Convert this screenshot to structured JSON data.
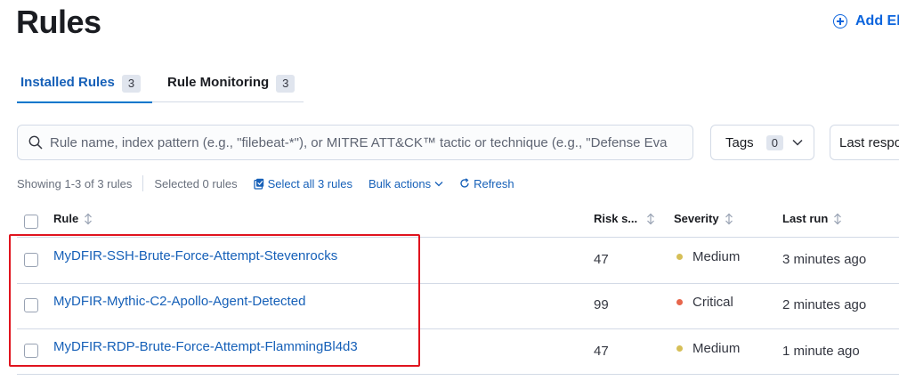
{
  "page": {
    "title": "Rules"
  },
  "header": {
    "add_button_label": "Add Ela"
  },
  "tabs": [
    {
      "label": "Installed Rules",
      "count": "3",
      "active": true
    },
    {
      "label": "Rule Monitoring",
      "count": "3",
      "active": false
    }
  ],
  "search": {
    "placeholder": "Rule name, index pattern (e.g., \"filebeat-*\"), or MITRE ATT&CK™ tactic or technique (e.g., \"Defense Eva"
  },
  "filters": {
    "tags_label": "Tags",
    "tags_count": "0",
    "last_response_label": "Last respo"
  },
  "toolbar": {
    "showing": "Showing 1-3 of 3 rules",
    "selected": "Selected 0 rules",
    "select_all": "Select all 3 rules",
    "bulk_actions": "Bulk actions",
    "refresh": "Refresh"
  },
  "table": {
    "columns": {
      "rule": "Rule",
      "risk": "Risk s...",
      "severity": "Severity",
      "last_run": "Last run"
    },
    "rows": [
      {
        "name": "MyDFIR-SSH-Brute-Force-Attempt-Stevenrocks",
        "risk": "47",
        "severity": "Medium",
        "severity_color": "#d6bf57",
        "last_run": "3 minutes ago"
      },
      {
        "name": "MyDFIR-Mythic-C2-Apollo-Agent-Detected",
        "risk": "99",
        "severity": "Critical",
        "severity_color": "#e7664c",
        "last_run": "2 minutes ago"
      },
      {
        "name": "MyDFIR-RDP-Brute-Force-Attempt-FlammingBl4d3",
        "risk": "47",
        "severity": "Medium",
        "severity_color": "#d6bf57",
        "last_run": "1 minute ago"
      }
    ]
  },
  "colors": {
    "link": "#1660b8",
    "highlight": "#e0141e"
  }
}
